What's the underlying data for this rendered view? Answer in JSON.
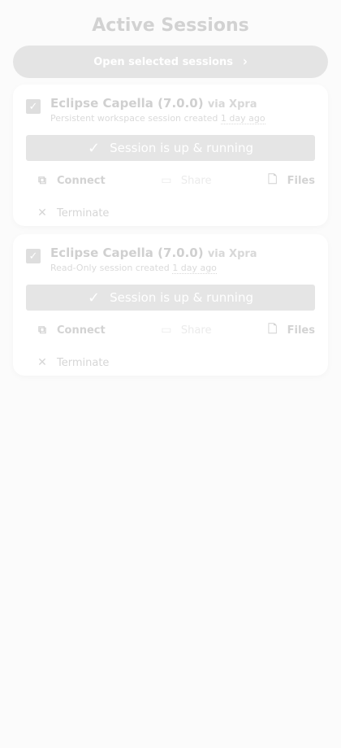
{
  "page": {
    "title": "Active Sessions"
  },
  "open_button": {
    "label": "Open selected sessions",
    "icon": "chevron-right-icon"
  },
  "sessions": [
    {
      "tool": "Eclipse Capella (7.0.0)",
      "via": "via Xpra",
      "description_prefix": "Persistent workspace session created",
      "created_ago": "1 day ago",
      "selected": true,
      "status": "Session is up & running",
      "actions": {
        "connect": "Connect",
        "share": "Share",
        "files": "Files",
        "terminate": "Terminate"
      }
    },
    {
      "tool": "Eclipse Capella (7.0.0)",
      "via": "via Xpra",
      "description_prefix": "Read-Only session created",
      "created_ago": "1 day ago",
      "selected": true,
      "status": "Session is up & running",
      "actions": {
        "connect": "Connect",
        "share": "Share",
        "files": "Files",
        "terminate": "Terminate"
      }
    }
  ],
  "colors": {
    "background": "#fbfbfb",
    "button_bg": "#e4e4e4",
    "status_bg": "#e5e5e5"
  }
}
